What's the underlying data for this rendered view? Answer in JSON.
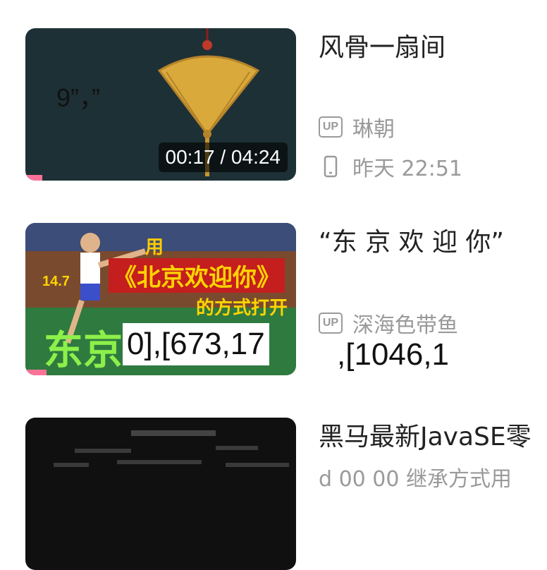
{
  "videos": [
    {
      "title": "风骨一扇间",
      "uploader_badge": "UP",
      "uploader": "琳朝",
      "date": "昨天 22:51",
      "duration": "00:17 / 04:24",
      "progress_fraction": 0.067,
      "thumb_text": "9”，”"
    },
    {
      "title": "“东 京 欢 迎 你”",
      "uploader_badge": "UP",
      "uploader": "深海色带鱼",
      "progress_fraction": 0.08,
      "thumb_caption_top": "用",
      "thumb_caption_main": "《北京欢迎你》",
      "thumb_caption_sub": "的方式打开",
      "thumb_caption_big": "东京",
      "thumb_score": "14.7",
      "thumb_overlay": "0],[673,17",
      "meta_overlay": ",[1046,1"
    },
    {
      "title": "黑马最新JavaSE零",
      "subtitle_partial": "d 00 00 继承方式用"
    }
  ],
  "icons": {
    "phone": "phone-icon"
  },
  "colors": {
    "accent": "#fb7299",
    "meta": "#9a9a9a"
  }
}
